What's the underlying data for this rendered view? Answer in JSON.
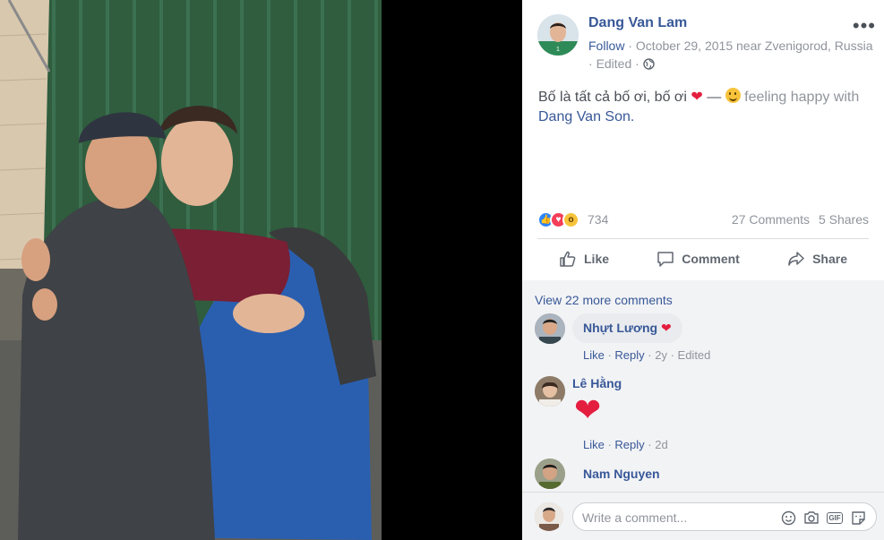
{
  "photo": {
    "alt": ""
  },
  "post": {
    "author": "Dang Van Lam",
    "follow_label": "Follow",
    "separator": " · ",
    "date": "October 29, 2015",
    "location": "near Zvenigorod, Russia",
    "edited": "Edited",
    "text_main": "Bố là tất cả bố ơi, bố ơi ",
    "text_dash": " — ",
    "feeling": " feeling happy with",
    "tagged": "Dang Van Son",
    "tagged_end": "."
  },
  "stats": {
    "reaction_count": "734",
    "comments": "27 Comments",
    "shares": "5 Shares"
  },
  "actions": {
    "like": "Like",
    "comment": "Comment",
    "share": "Share"
  },
  "comments": {
    "view_more": "View 22 more comments",
    "items": [
      {
        "name": "Nhựt Lương",
        "text": "❤",
        "like": "Like",
        "reply": "Reply",
        "time": "2y",
        "edited": "Edited"
      },
      {
        "name": "Lê Hằng",
        "text": "❤",
        "like": "Like",
        "reply": "Reply",
        "time": "2d"
      },
      {
        "name": "Nam Nguyen"
      }
    ]
  },
  "composer": {
    "placeholder": "Write a comment...",
    "gif_label": "GIF"
  },
  "colors": {
    "link": "#385898",
    "heart": "#e41e3f",
    "like_reaction": "#2d86ff",
    "love_reaction": "#f33e58"
  }
}
